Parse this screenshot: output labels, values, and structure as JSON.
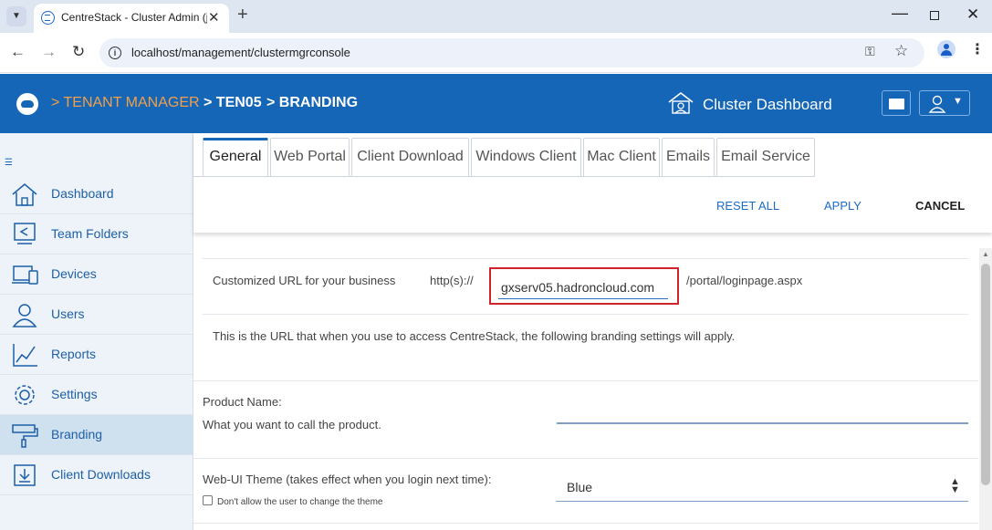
{
  "browser": {
    "tab_title": "CentreStack - Cluster Admin (jm",
    "url": "localhost/management/clustermgrconsole"
  },
  "header": {
    "crumb_tenant_manager": "> TENANT MANAGER",
    "crumb_ten05": "> TEN05",
    "crumb_branding": "> BRANDING",
    "dashboard_label": "Cluster Dashboard",
    "brand_color": "#1566b7"
  },
  "sidebar": {
    "items": [
      {
        "label": "Dashboard",
        "icon": "home-icon"
      },
      {
        "label": "Team Folders",
        "icon": "team-folders-icon"
      },
      {
        "label": "Devices",
        "icon": "devices-icon"
      },
      {
        "label": "Users",
        "icon": "users-icon"
      },
      {
        "label": "Reports",
        "icon": "reports-icon"
      },
      {
        "label": "Settings",
        "icon": "settings-icon"
      },
      {
        "label": "Branding",
        "icon": "branding-icon"
      },
      {
        "label": "Client Downloads",
        "icon": "client-downloads-icon"
      }
    ],
    "active": "Branding"
  },
  "tabs": [
    "General",
    "Web Portal",
    "Client Download",
    "Windows Client",
    "Mac Client",
    "Emails",
    "Email Service"
  ],
  "active_tab": "General",
  "actions": {
    "reset_all": "RESET ALL",
    "apply": "APPLY",
    "cancel": "CANCEL"
  },
  "form": {
    "custom_url_label": "Customized URL for your business",
    "url_prefix": "http(s)://",
    "url_value": "gxserv05.hadroncloud.com",
    "url_suffix": "/portal/loginpage.aspx",
    "url_help": "This is the URL that when you use to access CentreStack, the following branding settings will apply.",
    "product_name_label": "Product Name:",
    "product_name_help": "What you want to call the product.",
    "product_name_value": "",
    "theme_label": "Web-UI Theme (takes effect when you login next time):",
    "theme_value": "Blue",
    "theme_lock_label": "Don't allow the user to change the theme",
    "theme_lock_checked": false
  }
}
